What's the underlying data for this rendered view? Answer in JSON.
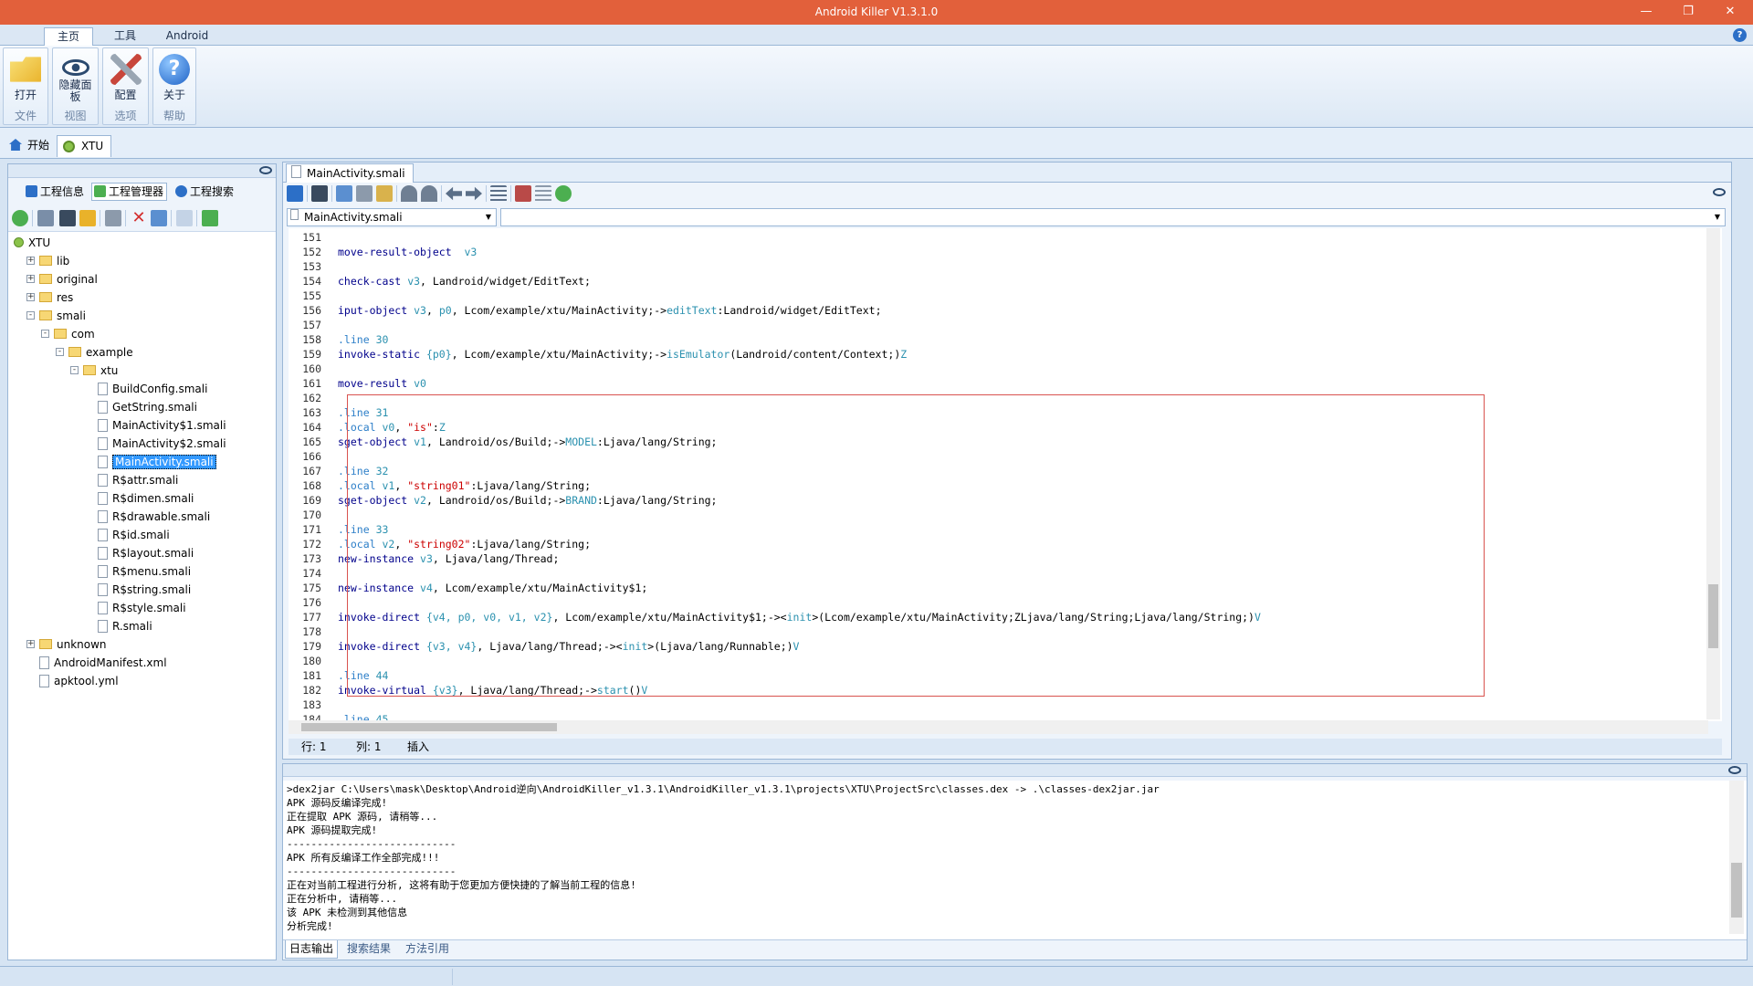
{
  "app": {
    "title": "Android Killer V1.3.1.0"
  },
  "menu": {
    "tabs": [
      "主页",
      "工具",
      "Android"
    ]
  },
  "ribbon": {
    "groups": [
      {
        "button": "打开",
        "group": "文件"
      },
      {
        "button": "隐藏面板",
        "group": "视图"
      },
      {
        "button": "配置",
        "group": "选项"
      },
      {
        "button": "关于",
        "group": "帮助"
      }
    ]
  },
  "doc_tabs": [
    "开始",
    "XTU"
  ],
  "left_panel": {
    "tabs": [
      "工程信息",
      "工程管理器",
      "工程搜索"
    ],
    "tree": [
      {
        "label": "XTU",
        "type": "root",
        "depth": 0
      },
      {
        "label": "lib",
        "type": "folder",
        "depth": 1,
        "expander": "+"
      },
      {
        "label": "original",
        "type": "folder",
        "depth": 1,
        "expander": "+"
      },
      {
        "label": "res",
        "type": "folder",
        "depth": 1,
        "expander": "+"
      },
      {
        "label": "smali",
        "type": "folder",
        "depth": 1,
        "expander": "-"
      },
      {
        "label": "com",
        "type": "folder",
        "depth": 2,
        "expander": "-"
      },
      {
        "label": "example",
        "type": "folder",
        "depth": 3,
        "expander": "-"
      },
      {
        "label": "xtu",
        "type": "folder",
        "depth": 4,
        "expander": "-"
      },
      {
        "label": "BuildConfig.smali",
        "type": "file",
        "depth": 5
      },
      {
        "label": "GetString.smali",
        "type": "file",
        "depth": 5
      },
      {
        "label": "MainActivity$1.smali",
        "type": "file",
        "depth": 5
      },
      {
        "label": "MainActivity$2.smali",
        "type": "file",
        "depth": 5
      },
      {
        "label": "MainActivity.smali",
        "type": "file",
        "depth": 5,
        "selected": true
      },
      {
        "label": "R$attr.smali",
        "type": "file",
        "depth": 5
      },
      {
        "label": "R$dimen.smali",
        "type": "file",
        "depth": 5
      },
      {
        "label": "R$drawable.smali",
        "type": "file",
        "depth": 5
      },
      {
        "label": "R$id.smali",
        "type": "file",
        "depth": 5
      },
      {
        "label": "R$layout.smali",
        "type": "file",
        "depth": 5
      },
      {
        "label": "R$menu.smali",
        "type": "file",
        "depth": 5
      },
      {
        "label": "R$string.smali",
        "type": "file",
        "depth": 5
      },
      {
        "label": "R$style.smali",
        "type": "file",
        "depth": 5
      },
      {
        "label": "R.smali",
        "type": "file",
        "depth": 5
      },
      {
        "label": "unknown",
        "type": "folder",
        "depth": 1,
        "expander": "+"
      },
      {
        "label": "AndroidManifest.xml",
        "type": "file",
        "depth": 1
      },
      {
        "label": "apktool.yml",
        "type": "file",
        "depth": 1
      }
    ]
  },
  "editor": {
    "tab": "MainActivity.smali",
    "file_select": "MainActivity.smali",
    "member_select": "",
    "lines": [
      {
        "n": "151",
        "code": []
      },
      {
        "n": "152",
        "code": [
          [
            "kw",
            "move-result-object"
          ],
          [
            "",
            "  "
          ],
          [
            "reg",
            "v3"
          ]
        ]
      },
      {
        "n": "153",
        "code": []
      },
      {
        "n": "154",
        "code": [
          [
            "kw",
            "check-cast"
          ],
          [
            "",
            " "
          ],
          [
            "reg",
            "v3"
          ],
          [
            "",
            ", Landroid/widget/EditText;"
          ]
        ]
      },
      {
        "n": "155",
        "code": []
      },
      {
        "n": "156",
        "code": [
          [
            "kw",
            "iput-object"
          ],
          [
            "",
            " "
          ],
          [
            "reg",
            "v3"
          ],
          [
            "",
            ", "
          ],
          [
            "reg",
            "p0"
          ],
          [
            "",
            ", Lcom/example/xtu/MainActivity;->"
          ],
          [
            "mem",
            "editText"
          ],
          [
            "",
            ":Landroid/widget/EditText;"
          ]
        ]
      },
      {
        "n": "157",
        "code": []
      },
      {
        "n": "158",
        "code": [
          [
            "lb",
            ".line"
          ],
          [
            "",
            " "
          ],
          [
            "reg",
            "30"
          ]
        ]
      },
      {
        "n": "159",
        "code": [
          [
            "kw",
            "invoke-static"
          ],
          [
            "",
            " "
          ],
          [
            "reg",
            "{p0}"
          ],
          [
            "",
            ", Lcom/example/xtu/MainActivity;->"
          ],
          [
            "mem",
            "isEmulator"
          ],
          [
            "",
            "(Landroid/content/Context;)"
          ],
          [
            "reg",
            "Z"
          ]
        ]
      },
      {
        "n": "160",
        "code": []
      },
      {
        "n": "161",
        "code": [
          [
            "kw",
            "move-result"
          ],
          [
            "",
            " "
          ],
          [
            "reg",
            "v0"
          ]
        ]
      },
      {
        "n": "162",
        "code": []
      },
      {
        "n": "163",
        "code": [
          [
            "lb",
            ".line"
          ],
          [
            "",
            " "
          ],
          [
            "reg",
            "31"
          ]
        ]
      },
      {
        "n": "164",
        "code": [
          [
            "lb",
            ".local"
          ],
          [
            "",
            " "
          ],
          [
            "reg",
            "v0"
          ],
          [
            "",
            ", "
          ],
          [
            "str",
            "\"is\""
          ],
          [
            "",
            ":"
          ],
          [
            "reg",
            "Z"
          ]
        ]
      },
      {
        "n": "165",
        "code": [
          [
            "kw",
            "sget-object"
          ],
          [
            "",
            " "
          ],
          [
            "reg",
            "v1"
          ],
          [
            "",
            ", Landroid/os/Build;->"
          ],
          [
            "mem",
            "MODEL"
          ],
          [
            "",
            ":Ljava/lang/String;"
          ]
        ]
      },
      {
        "n": "166",
        "code": []
      },
      {
        "n": "167",
        "code": [
          [
            "lb",
            ".line"
          ],
          [
            "",
            " "
          ],
          [
            "reg",
            "32"
          ]
        ]
      },
      {
        "n": "168",
        "code": [
          [
            "lb",
            ".local"
          ],
          [
            "",
            " "
          ],
          [
            "reg",
            "v1"
          ],
          [
            "",
            ", "
          ],
          [
            "str",
            "\"string01\""
          ],
          [
            "",
            ":Ljava/lang/String;"
          ]
        ]
      },
      {
        "n": "169",
        "code": [
          [
            "kw",
            "sget-object"
          ],
          [
            "",
            " "
          ],
          [
            "reg",
            "v2"
          ],
          [
            "",
            ", Landroid/os/Build;->"
          ],
          [
            "mem",
            "BRAND"
          ],
          [
            "",
            ":Ljava/lang/String;"
          ]
        ]
      },
      {
        "n": "170",
        "code": []
      },
      {
        "n": "171",
        "code": [
          [
            "lb",
            ".line"
          ],
          [
            "",
            " "
          ],
          [
            "reg",
            "33"
          ]
        ]
      },
      {
        "n": "172",
        "code": [
          [
            "lb",
            ".local"
          ],
          [
            "",
            " "
          ],
          [
            "reg",
            "v2"
          ],
          [
            "",
            ", "
          ],
          [
            "str",
            "\"string02\""
          ],
          [
            "",
            ":Ljava/lang/String;"
          ]
        ]
      },
      {
        "n": "173",
        "code": [
          [
            "kw",
            "new-instance"
          ],
          [
            "",
            " "
          ],
          [
            "reg",
            "v3"
          ],
          [
            "",
            ", Ljava/lang/Thread;"
          ]
        ]
      },
      {
        "n": "174",
        "code": []
      },
      {
        "n": "175",
        "code": [
          [
            "kw",
            "new-instance"
          ],
          [
            "",
            " "
          ],
          [
            "reg",
            "v4"
          ],
          [
            "",
            ", Lcom/example/xtu/MainActivity$1;"
          ]
        ]
      },
      {
        "n": "176",
        "code": []
      },
      {
        "n": "177",
        "code": [
          [
            "kw",
            "invoke-direct"
          ],
          [
            "",
            " "
          ],
          [
            "reg",
            "{v4, p0, v0, v1, v2}"
          ],
          [
            "",
            ", Lcom/example/xtu/MainActivity$1;-><"
          ],
          [
            "mem",
            "init"
          ],
          [
            "",
            ">(Lcom/example/xtu/MainActivity;ZLjava/lang/String;Ljava/lang/String;)"
          ],
          [
            "reg",
            "V"
          ]
        ]
      },
      {
        "n": "178",
        "code": []
      },
      {
        "n": "179",
        "code": [
          [
            "kw",
            "invoke-direct"
          ],
          [
            "",
            " "
          ],
          [
            "reg",
            "{v3, v4}"
          ],
          [
            "",
            ", Ljava/lang/Thread;-><"
          ],
          [
            "mem",
            "init"
          ],
          [
            "",
            ">(Ljava/lang/Runnable;)"
          ],
          [
            "reg",
            "V"
          ]
        ]
      },
      {
        "n": "180",
        "code": []
      },
      {
        "n": "181",
        "code": [
          [
            "lb",
            ".line"
          ],
          [
            "",
            " "
          ],
          [
            "reg",
            "44"
          ]
        ]
      },
      {
        "n": "182",
        "code": [
          [
            "kw",
            "invoke-virtual"
          ],
          [
            "",
            " "
          ],
          [
            "reg",
            "{v3}"
          ],
          [
            "",
            ", Ljava/lang/Thread;->"
          ],
          [
            "mem",
            "start"
          ],
          [
            "",
            "()"
          ],
          [
            "reg",
            "V"
          ]
        ]
      },
      {
        "n": "183",
        "code": []
      },
      {
        "n": "184",
        "code": [
          [
            "lb",
            ".line"
          ],
          [
            "",
            " "
          ],
          [
            "reg",
            "45"
          ]
        ]
      }
    ],
    "status": {
      "row": "行: 1",
      "col": "列: 1",
      "mode": "插入"
    }
  },
  "output": {
    "log": [
      ">dex2jar C:\\Users\\mask\\Desktop\\Android逆向\\AndroidKiller_v1.3.1\\AndroidKiller_v1.3.1\\projects\\XTU\\ProjectSrc\\classes.dex -> .\\classes-dex2jar.jar",
      "APK 源码反编译完成!",
      "正在提取 APK 源码, 请稍等...",
      "APK 源码提取完成!",
      "----------------------------",
      "APK 所有反编译工作全部完成!!!",
      "----------------------------",
      "正在对当前工程进行分析, 这将有助于您更加方便快捷的了解当前工程的信息!",
      "正在分析中, 请稍等...",
      "该 APK 未检测到其他信息",
      "分析完成!"
    ],
    "tabs": [
      "日志输出",
      "搜索结果",
      "方法引用"
    ]
  }
}
